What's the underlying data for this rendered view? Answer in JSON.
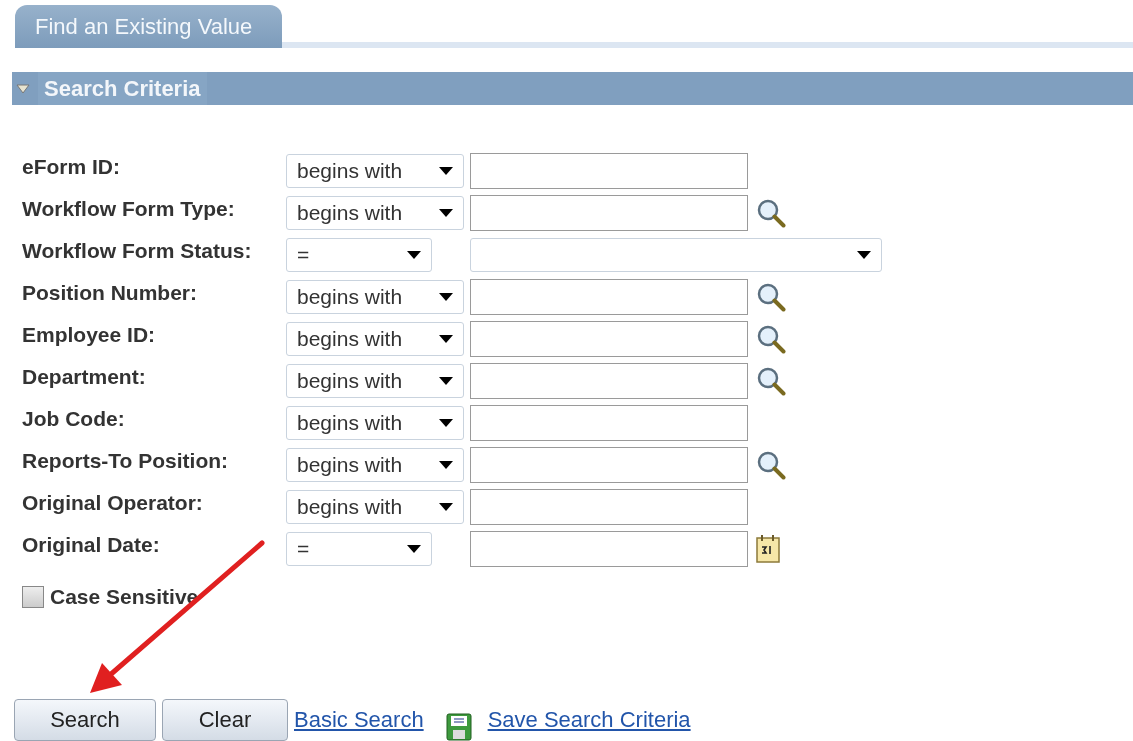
{
  "tabs": [
    {
      "label": "Find an Existing Value",
      "selected": true
    }
  ],
  "section": {
    "title": "Search Criteria",
    "expanded": true
  },
  "fields": [
    {
      "label": "eForm ID:",
      "operator": "begins with",
      "kind": "text"
    },
    {
      "label": "Workflow Form Type:",
      "operator": "begins with",
      "kind": "lookup"
    },
    {
      "label": "Workflow Form Status:",
      "operator": "=",
      "kind": "dropdown"
    },
    {
      "label": "Position Number:",
      "operator": "begins with",
      "kind": "lookup"
    },
    {
      "label": "Employee ID:",
      "operator": "begins with",
      "kind": "lookup"
    },
    {
      "label": "Department:",
      "operator": "begins with",
      "kind": "lookup"
    },
    {
      "label": "Job Code:",
      "operator": "begins with",
      "kind": "text"
    },
    {
      "label": "Reports-To Position:",
      "operator": "begins with",
      "kind": "lookup"
    },
    {
      "label": "Original Operator:",
      "operator": "begins with",
      "kind": "text"
    },
    {
      "label": "Original Date:",
      "operator": "=",
      "kind": "date"
    }
  ],
  "case_sensitive": {
    "label": "Case Sensitive",
    "checked": false
  },
  "buttons": [
    "Search",
    "Clear"
  ],
  "links": [
    {
      "label": "Basic Search",
      "kind": "link"
    },
    {
      "label": "Save Search Criteria",
      "kind": "save"
    }
  ]
}
